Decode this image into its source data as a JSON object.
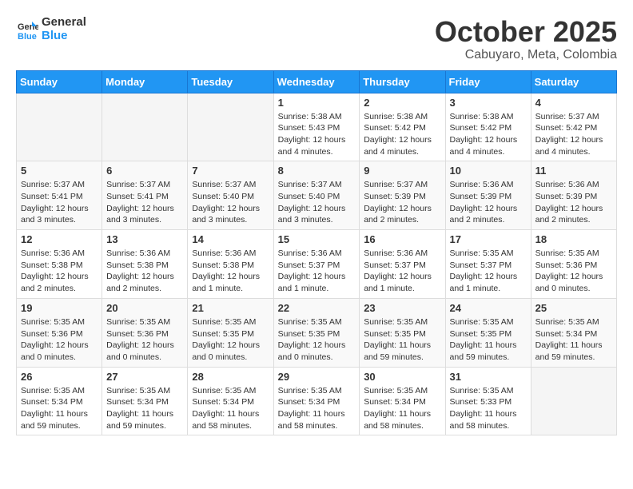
{
  "logo": {
    "line1": "General",
    "line2": "Blue"
  },
  "title": "October 2025",
  "subtitle": "Cabuyaro, Meta, Colombia",
  "days_of_week": [
    "Sunday",
    "Monday",
    "Tuesday",
    "Wednesday",
    "Thursday",
    "Friday",
    "Saturday"
  ],
  "weeks": [
    [
      {
        "day": "",
        "info": ""
      },
      {
        "day": "",
        "info": ""
      },
      {
        "day": "",
        "info": ""
      },
      {
        "day": "1",
        "info": "Sunrise: 5:38 AM\nSunset: 5:43 PM\nDaylight: 12 hours\nand 4 minutes."
      },
      {
        "day": "2",
        "info": "Sunrise: 5:38 AM\nSunset: 5:42 PM\nDaylight: 12 hours\nand 4 minutes."
      },
      {
        "day": "3",
        "info": "Sunrise: 5:38 AM\nSunset: 5:42 PM\nDaylight: 12 hours\nand 4 minutes."
      },
      {
        "day": "4",
        "info": "Sunrise: 5:37 AM\nSunset: 5:42 PM\nDaylight: 12 hours\nand 4 minutes."
      }
    ],
    [
      {
        "day": "5",
        "info": "Sunrise: 5:37 AM\nSunset: 5:41 PM\nDaylight: 12 hours\nand 3 minutes."
      },
      {
        "day": "6",
        "info": "Sunrise: 5:37 AM\nSunset: 5:41 PM\nDaylight: 12 hours\nand 3 minutes."
      },
      {
        "day": "7",
        "info": "Sunrise: 5:37 AM\nSunset: 5:40 PM\nDaylight: 12 hours\nand 3 minutes."
      },
      {
        "day": "8",
        "info": "Sunrise: 5:37 AM\nSunset: 5:40 PM\nDaylight: 12 hours\nand 3 minutes."
      },
      {
        "day": "9",
        "info": "Sunrise: 5:37 AM\nSunset: 5:39 PM\nDaylight: 12 hours\nand 2 minutes."
      },
      {
        "day": "10",
        "info": "Sunrise: 5:36 AM\nSunset: 5:39 PM\nDaylight: 12 hours\nand 2 minutes."
      },
      {
        "day": "11",
        "info": "Sunrise: 5:36 AM\nSunset: 5:39 PM\nDaylight: 12 hours\nand 2 minutes."
      }
    ],
    [
      {
        "day": "12",
        "info": "Sunrise: 5:36 AM\nSunset: 5:38 PM\nDaylight: 12 hours\nand 2 minutes."
      },
      {
        "day": "13",
        "info": "Sunrise: 5:36 AM\nSunset: 5:38 PM\nDaylight: 12 hours\nand 2 minutes."
      },
      {
        "day": "14",
        "info": "Sunrise: 5:36 AM\nSunset: 5:38 PM\nDaylight: 12 hours\nand 1 minute."
      },
      {
        "day": "15",
        "info": "Sunrise: 5:36 AM\nSunset: 5:37 PM\nDaylight: 12 hours\nand 1 minute."
      },
      {
        "day": "16",
        "info": "Sunrise: 5:36 AM\nSunset: 5:37 PM\nDaylight: 12 hours\nand 1 minute."
      },
      {
        "day": "17",
        "info": "Sunrise: 5:35 AM\nSunset: 5:37 PM\nDaylight: 12 hours\nand 1 minute."
      },
      {
        "day": "18",
        "info": "Sunrise: 5:35 AM\nSunset: 5:36 PM\nDaylight: 12 hours\nand 0 minutes."
      }
    ],
    [
      {
        "day": "19",
        "info": "Sunrise: 5:35 AM\nSunset: 5:36 PM\nDaylight: 12 hours\nand 0 minutes."
      },
      {
        "day": "20",
        "info": "Sunrise: 5:35 AM\nSunset: 5:36 PM\nDaylight: 12 hours\nand 0 minutes."
      },
      {
        "day": "21",
        "info": "Sunrise: 5:35 AM\nSunset: 5:35 PM\nDaylight: 12 hours\nand 0 minutes."
      },
      {
        "day": "22",
        "info": "Sunrise: 5:35 AM\nSunset: 5:35 PM\nDaylight: 12 hours\nand 0 minutes."
      },
      {
        "day": "23",
        "info": "Sunrise: 5:35 AM\nSunset: 5:35 PM\nDaylight: 11 hours\nand 59 minutes."
      },
      {
        "day": "24",
        "info": "Sunrise: 5:35 AM\nSunset: 5:35 PM\nDaylight: 11 hours\nand 59 minutes."
      },
      {
        "day": "25",
        "info": "Sunrise: 5:35 AM\nSunset: 5:34 PM\nDaylight: 11 hours\nand 59 minutes."
      }
    ],
    [
      {
        "day": "26",
        "info": "Sunrise: 5:35 AM\nSunset: 5:34 PM\nDaylight: 11 hours\nand 59 minutes."
      },
      {
        "day": "27",
        "info": "Sunrise: 5:35 AM\nSunset: 5:34 PM\nDaylight: 11 hours\nand 59 minutes."
      },
      {
        "day": "28",
        "info": "Sunrise: 5:35 AM\nSunset: 5:34 PM\nDaylight: 11 hours\nand 58 minutes."
      },
      {
        "day": "29",
        "info": "Sunrise: 5:35 AM\nSunset: 5:34 PM\nDaylight: 11 hours\nand 58 minutes."
      },
      {
        "day": "30",
        "info": "Sunrise: 5:35 AM\nSunset: 5:34 PM\nDaylight: 11 hours\nand 58 minutes."
      },
      {
        "day": "31",
        "info": "Sunrise: 5:35 AM\nSunset: 5:33 PM\nDaylight: 11 hours\nand 58 minutes."
      },
      {
        "day": "",
        "info": ""
      }
    ]
  ]
}
